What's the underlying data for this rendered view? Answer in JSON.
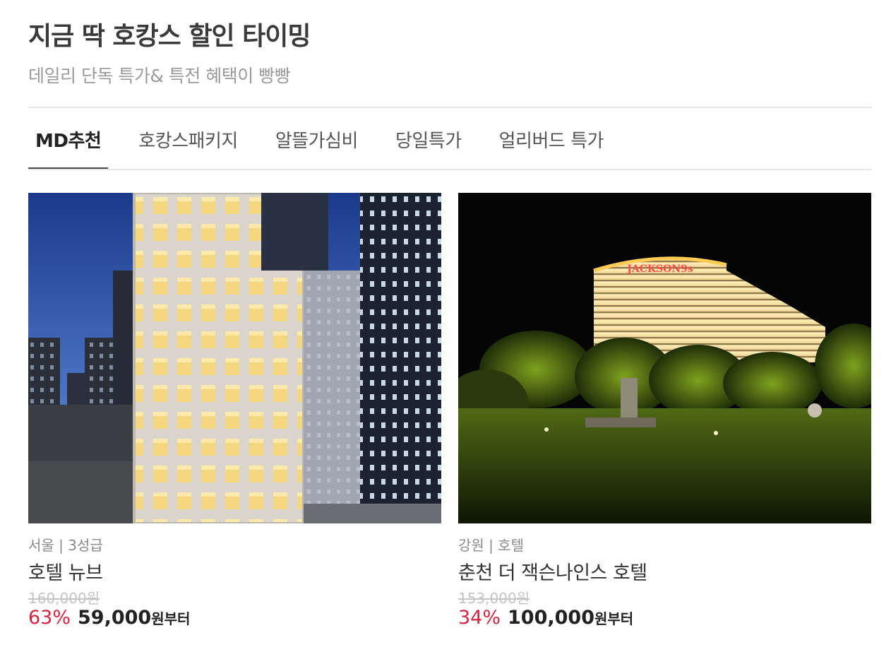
{
  "header": {
    "title": "지금 딱 호캉스 할인 타이밍",
    "subtitle": "데일리 단독 특가& 특전 혜택이 빵빵"
  },
  "tabs": [
    {
      "label": "MD추천",
      "active": true
    },
    {
      "label": "호캉스패키지",
      "active": false
    },
    {
      "label": "알뜰가심비",
      "active": false
    },
    {
      "label": "당일특가",
      "active": false
    },
    {
      "label": "얼리버드 특가",
      "active": false
    }
  ],
  "products": [
    {
      "meta": "서울 | 3성급",
      "name": "호텔 뉴브",
      "original_price": "160,000원",
      "discount": "63%",
      "price": "59,000",
      "price_suffix": "원부터",
      "image": "hotel-building-night-photo"
    },
    {
      "meta": "강원 | 호텔",
      "name": "춘천 더 잭슨나인스 호텔",
      "original_price": "153,000원",
      "discount": "34%",
      "price": "100,000",
      "price_suffix": "원부터",
      "image": "resort-hotel-night-garden-photo",
      "sign_text": "JACKSON9s"
    }
  ],
  "colors": {
    "accent_discount": "#d4253f",
    "tab_indicator": "#4a4a4a",
    "divider": "#e6e6e6"
  }
}
